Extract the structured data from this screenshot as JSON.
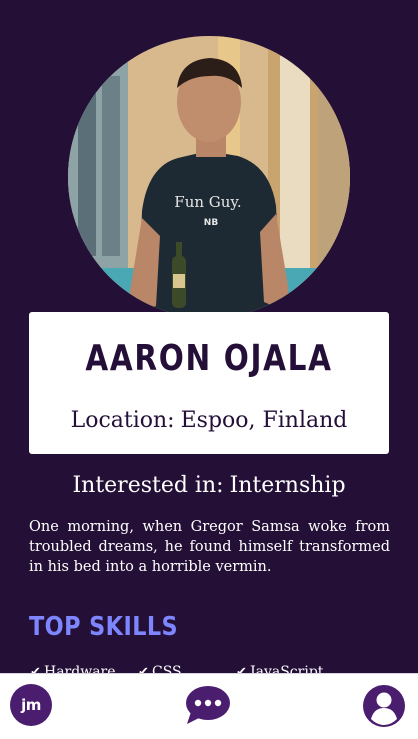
{
  "profile": {
    "name": "AARON OJALA",
    "location_label": "Location:",
    "location_value": "Espoo, Finland",
    "interest_label": "Interested in:",
    "interest_value": "Internship",
    "bio": "One morning, when Gregor Samsa woke from troubled dreams, he found himself transformed in his bed into a horrible vermin.",
    "photo_shirt_text": "Fun Guy.",
    "photo_shirt_brand": "NB"
  },
  "skills": {
    "heading": "TOP SKILLS",
    "items": [
      {
        "label": "Hardware",
        "icon": "check-icon"
      },
      {
        "label": "CSS",
        "icon": "check-icon"
      },
      {
        "label": "JavaScript",
        "icon": "check-icon"
      }
    ]
  },
  "nav": {
    "home_logo": "jm",
    "home_icon": "jm-logo-icon",
    "messages_icon": "chat-bubble-icon",
    "profile_icon": "user-icon"
  },
  "colors": {
    "background": "#241037",
    "card": "#ffffff",
    "name_text": "#240f38",
    "skills_heading": "#7d86ff",
    "nav_icon": "#4a1d6e"
  }
}
